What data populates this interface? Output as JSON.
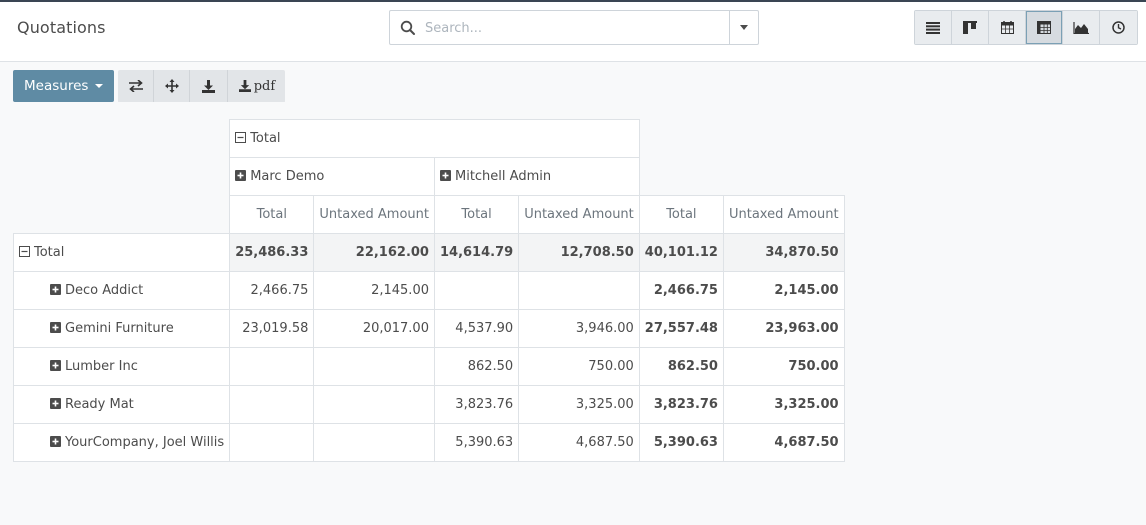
{
  "header": {
    "title": "Quotations",
    "search_placeholder": "Search..."
  },
  "views": [
    {
      "name": "list-view-icon",
      "active": false
    },
    {
      "name": "kanban-view-icon",
      "active": false
    },
    {
      "name": "calendar-view-icon",
      "active": false
    },
    {
      "name": "pivot-view-icon",
      "active": true
    },
    {
      "name": "graph-view-icon",
      "active": false
    },
    {
      "name": "activity-view-icon",
      "active": false
    }
  ],
  "toolbar": {
    "measures_label": "Measures",
    "pdf_label": "pdf"
  },
  "pivot": {
    "col_total_label": "Total",
    "col_groups": [
      "Marc Demo",
      "Mitchell Admin"
    ],
    "measures": [
      "Total",
      "Untaxed Amount",
      "Total",
      "Untaxed Amount",
      "Total",
      "Untaxed Amount"
    ],
    "total_row": {
      "label": "Total",
      "cells": [
        "25,486.33",
        "22,162.00",
        "14,614.79",
        "12,708.50",
        "40,101.12",
        "34,870.50"
      ]
    },
    "rows": [
      {
        "label": "Deco Addict",
        "cells": [
          "2,466.75",
          "2,145.00",
          "",
          "",
          "2,466.75",
          "2,145.00"
        ]
      },
      {
        "label": "Gemini Furniture",
        "cells": [
          "23,019.58",
          "20,017.00",
          "4,537.90",
          "3,946.00",
          "27,557.48",
          "23,963.00"
        ]
      },
      {
        "label": "Lumber Inc",
        "cells": [
          "",
          "",
          "862.50",
          "750.00",
          "862.50",
          "750.00"
        ]
      },
      {
        "label": "Ready Mat",
        "cells": [
          "",
          "",
          "3,823.76",
          "3,325.00",
          "3,823.76",
          "3,325.00"
        ]
      },
      {
        "label": "YourCompany, Joel Willis",
        "cells": [
          "",
          "",
          "5,390.63",
          "4,687.50",
          "5,390.63",
          "4,687.50"
        ]
      }
    ]
  },
  "colors": {
    "accent": "#5f8ba4",
    "topbar": "#3a4553"
  }
}
